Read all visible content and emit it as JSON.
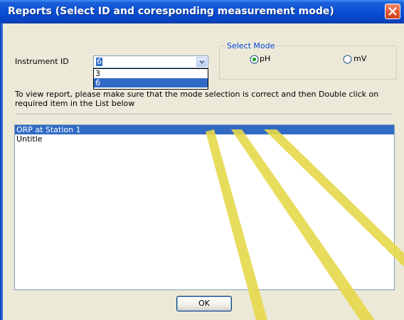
{
  "window": {
    "title": "Reports (Select ID and coresponding measurement mode)",
    "titlebar_color": "#0a4fd3"
  },
  "instrument": {
    "label": "Instrument ID",
    "selected": "6",
    "options": [
      "3",
      "6"
    ],
    "highlighted_option": "6"
  },
  "mode": {
    "group_label": "Select Mode",
    "options": [
      {
        "label": "pH",
        "checked": true
      },
      {
        "label": "mV",
        "checked": false
      }
    ]
  },
  "instructions": "To view report, please make sure that the mode selection is correct and then Double click on required item in the List below",
  "reports": {
    "items": [
      {
        "label": "ORP at Station 1",
        "selected": true
      },
      {
        "label": "Untitle",
        "selected": false
      }
    ],
    "selection_color": "#316ac5"
  },
  "buttons": {
    "ok_label": "OK"
  },
  "icons": {
    "close": "close-icon",
    "dropdown": "chevron-down-icon",
    "radio": "radio-icon"
  }
}
